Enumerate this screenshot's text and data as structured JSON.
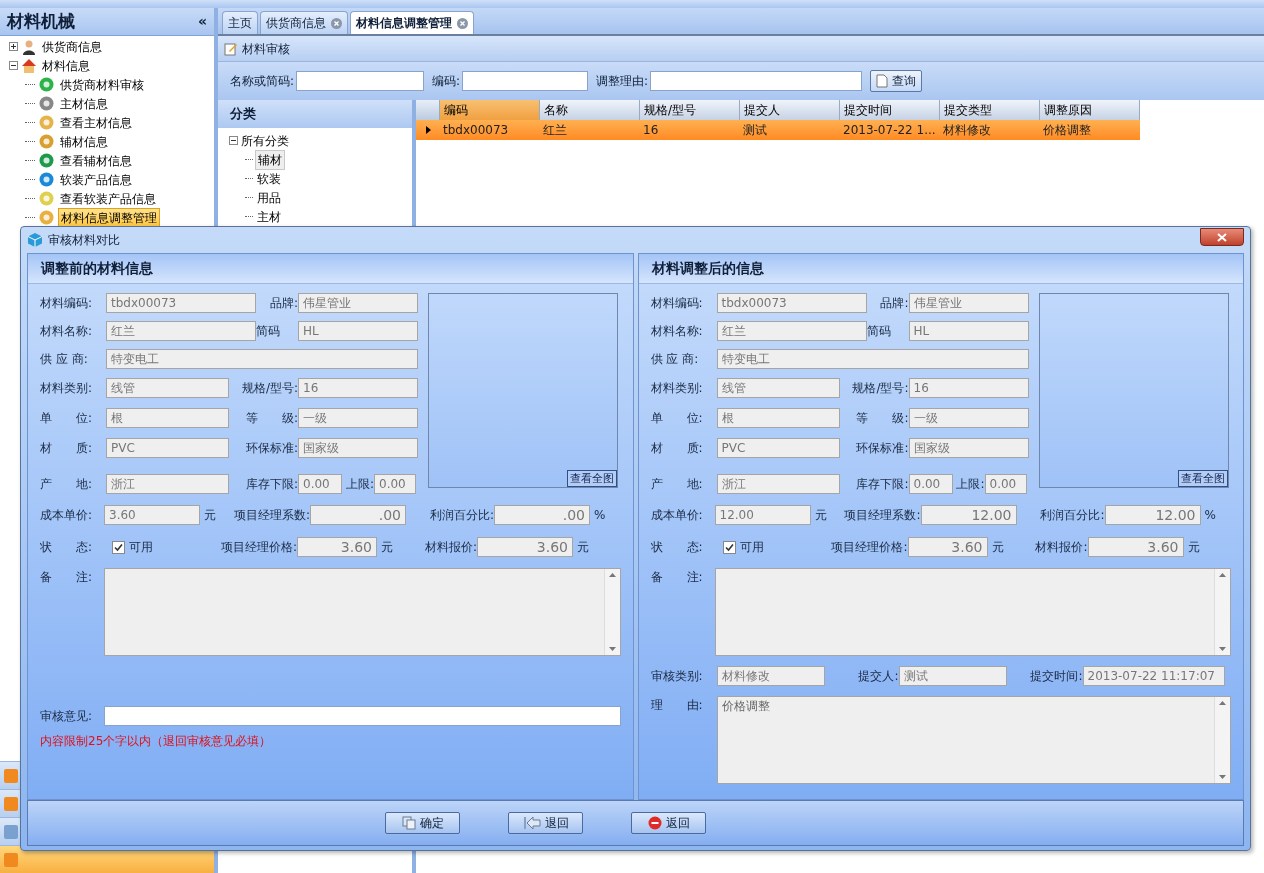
{
  "sidebar": {
    "title": "材料机械",
    "collapse": "«",
    "tree": [
      {
        "label": "供货商信息",
        "expanded": false,
        "selected": false
      },
      {
        "label": "材料信息",
        "expanded": true,
        "selected": false,
        "children": [
          {
            "label": "供货商材料审核",
            "selected": false
          },
          {
            "label": "主材信息",
            "selected": false
          },
          {
            "label": "查看主材信息",
            "selected": false
          },
          {
            "label": "辅材信息",
            "selected": false
          },
          {
            "label": "查看辅材信息",
            "selected": false
          },
          {
            "label": "软装产品信息",
            "selected": false
          },
          {
            "label": "查看软装产品信息",
            "selected": false
          },
          {
            "label": "材料信息调整管理",
            "selected": true
          }
        ]
      }
    ]
  },
  "tabs": [
    {
      "label": "主页",
      "selected": false,
      "closable": false
    },
    {
      "label": "供货商信息",
      "selected": false,
      "closable": true
    },
    {
      "label": "材料信息调整管理",
      "selected": true,
      "closable": true
    }
  ],
  "toolbar": {
    "title": "材料审核"
  },
  "search": {
    "fields": [
      {
        "label": "名称或简码:"
      },
      {
        "label": "编码:"
      },
      {
        "label": "调整理由:"
      }
    ],
    "button": "查询"
  },
  "category": {
    "title": "分类",
    "tree": {
      "label": "所有分类",
      "expanded": true,
      "children": [
        {
          "label": "辅材",
          "selected": true
        },
        {
          "label": "软装",
          "selected": false
        },
        {
          "label": "用品",
          "selected": false
        },
        {
          "label": "主材",
          "selected": false
        }
      ]
    }
  },
  "grid": {
    "columns": [
      "编码",
      "名称",
      "规格/型号",
      "提交人",
      "提交时间",
      "提交类型",
      "调整原因"
    ],
    "rows": [
      {
        "selected": true,
        "cells": [
          "tbdx00073",
          "红兰",
          "16",
          "测试",
          "2013-07-22 1...",
          "材料修改",
          "价格调整"
        ]
      }
    ]
  },
  "dialog": {
    "title": "审核材料对比",
    "panels": [
      {
        "title": "调整前的材料信息",
        "fields": [
          {
            "label": "材料编码:",
            "value": "tbdx00073"
          },
          {
            "label": "品牌:",
            "value": "伟星管业"
          },
          {
            "label": "材料名称:",
            "value": "红兰"
          },
          {
            "label": "简码",
            "value": "HL"
          },
          {
            "label": "供 应 商:",
            "value": "特变电工"
          },
          {
            "label": "材料类别:",
            "value": "线管"
          },
          {
            "label": "规格/型号:",
            "value": "16"
          },
          {
            "label": "单　　位:",
            "value": "根"
          },
          {
            "label": "等　　级:",
            "value": "一级"
          },
          {
            "label": "材　　质:",
            "value": "PVC"
          },
          {
            "label": "环保标准:",
            "value": "国家级"
          },
          {
            "label": "产　　地:",
            "value": "浙江"
          },
          {
            "label": "库存下限:",
            "value": "0.00"
          },
          {
            "label": "上限:",
            "value": "0.00"
          },
          {
            "label": "成本单价:",
            "value": "3.60",
            "unit": "元"
          },
          {
            "label": "项目经理系数:",
            "value": ".00"
          },
          {
            "label": "利润百分比:",
            "value": ".00",
            "unit": "%"
          },
          {
            "label": "项目经理价格:",
            "value": "3.60",
            "unit": "元"
          },
          {
            "label": "材料报价:",
            "value": "3.60",
            "unit": "元"
          }
        ],
        "view_button": "查看全图",
        "status": {
          "label": "状　　态:",
          "text": "可用",
          "checked": true
        },
        "remarks": {
          "label": "备　　注:"
        },
        "review": {
          "label": "审核意见:",
          "note": "内容限制25个字以内（退回审核意见必填）"
        }
      },
      {
        "title": "材料调整后的信息",
        "fields": [
          {
            "label": "材料编码:",
            "value": "tbdx00073"
          },
          {
            "label": "品牌:",
            "value": "伟星管业"
          },
          {
            "label": "材料名称:",
            "value": "红兰"
          },
          {
            "label": "简码",
            "value": "HL"
          },
          {
            "label": "供 应 商:",
            "value": "特变电工"
          },
          {
            "label": "材料类别:",
            "value": "线管"
          },
          {
            "label": "规格/型号:",
            "value": "16"
          },
          {
            "label": "单　　位:",
            "value": "根"
          },
          {
            "label": "等　　级:",
            "value": "一级"
          },
          {
            "label": "材　　质:",
            "value": "PVC"
          },
          {
            "label": "环保标准:",
            "value": "国家级"
          },
          {
            "label": "产　　地:",
            "value": "浙江"
          },
          {
            "label": "库存下限:",
            "value": "0.00"
          },
          {
            "label": "上限:",
            "value": "0.00"
          },
          {
            "label": "成本单价:",
            "value": "12.00",
            "unit": "元"
          },
          {
            "label": "项目经理系数:",
            "value": "12.00"
          },
          {
            "label": "利润百分比:",
            "value": "12.00",
            "unit": "%"
          },
          {
            "label": "项目经理价格:",
            "value": "3.60",
            "unit": "元"
          },
          {
            "label": "材料报价:",
            "value": "3.60",
            "unit": "元"
          }
        ],
        "view_button": "查看全图",
        "status": {
          "label": "状　　态:",
          "text": "可用",
          "checked": true
        },
        "remarks": {
          "label": "备　　注:"
        },
        "submission": [
          {
            "label": "审核类别:",
            "value": "材料修改"
          },
          {
            "label": "提交人:",
            "value": "测试"
          },
          {
            "label": "提交时间:",
            "value": "2013-07-22 11:17:07"
          }
        ],
        "reason": {
          "label": "理　　由:",
          "value": "价格调整"
        }
      }
    ],
    "buttons": [
      {
        "label": "确定",
        "kind": "confirm"
      },
      {
        "label": "退回",
        "kind": "reject"
      },
      {
        "label": "返回",
        "kind": "back"
      }
    ]
  }
}
